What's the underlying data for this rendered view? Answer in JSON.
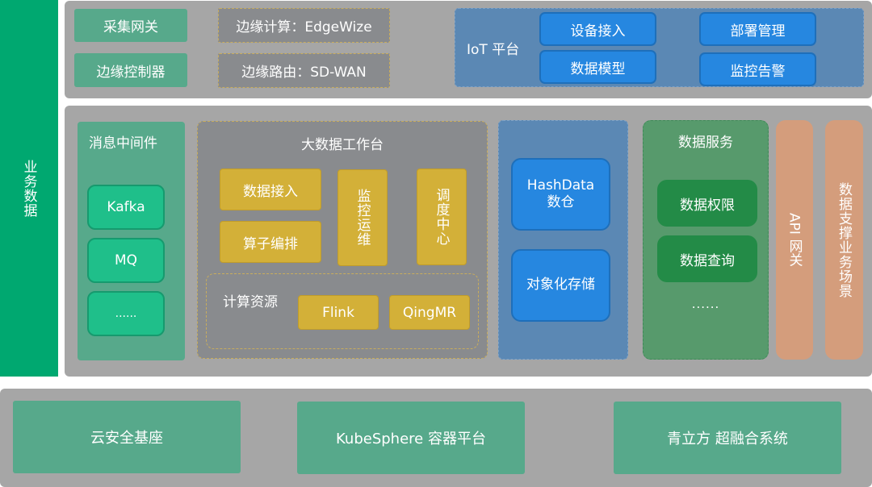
{
  "left_bar": {
    "label": "业务数据"
  },
  "top_layer": {
    "edge_items": [
      "采集网关",
      "边缘控制器"
    ],
    "edge_services": [
      "边缘计算：EdgeWize",
      "边缘路由：SD-WAN"
    ],
    "iot_platform": {
      "label": "IoT 平台",
      "items": [
        "设备接入",
        "部署管理",
        "数据模型",
        "监控告警"
      ]
    }
  },
  "middle_layer": {
    "middleware": {
      "title": "消息中间件",
      "items": [
        "Kafka",
        "MQ",
        "......"
      ]
    },
    "bigdata_workbench": {
      "title": "大数据工作台",
      "items": [
        "数据接入",
        "算子编排"
      ],
      "monitor": "监控运维",
      "scheduler": "调度中心",
      "compute": {
        "label": "计算资源",
        "items": [
          "Flink",
          "QingMR"
        ]
      }
    },
    "storage": {
      "items": [
        "HashData",
        "数仓",
        "对象化存储"
      ]
    },
    "data_service": {
      "title": "数据服务",
      "items": [
        "数据权限",
        "数据查询"
      ],
      "more": "......"
    },
    "api_gateway": "API 网关",
    "business_support": "数据支撑业务场景"
  },
  "bottom_layer": {
    "items": [
      "云安全基座",
      "KubeSphere 容器平台",
      "青立方 超融合系统"
    ]
  }
}
